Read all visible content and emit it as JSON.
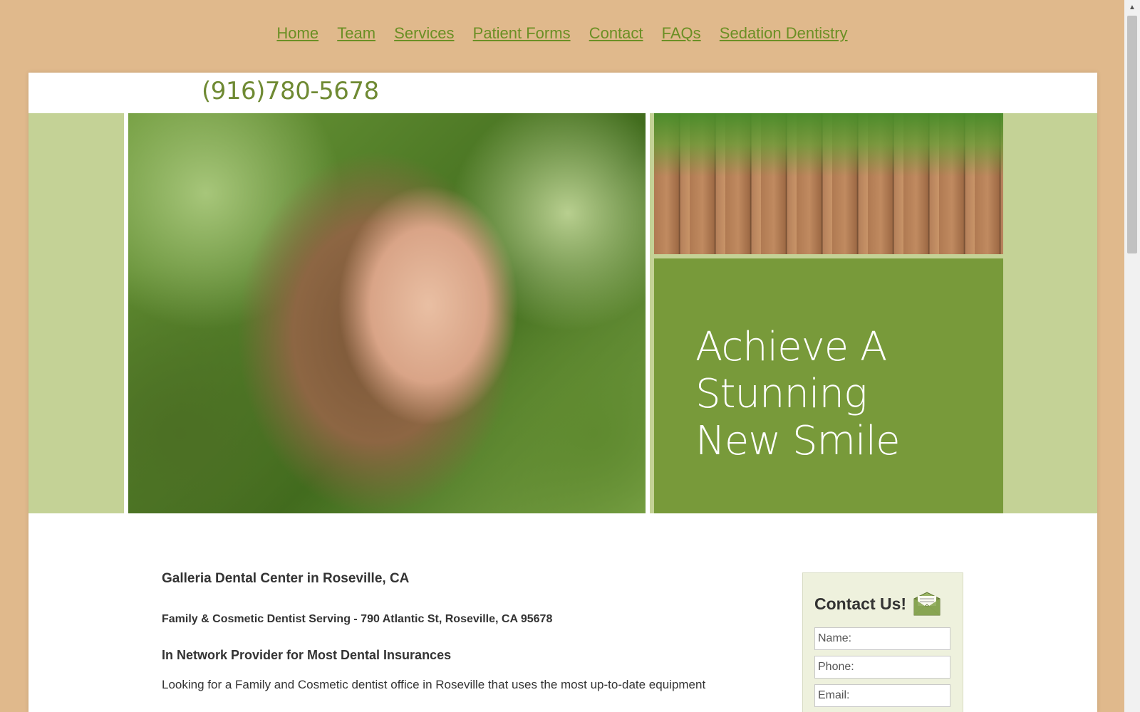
{
  "nav": {
    "items": [
      "Home",
      "Team",
      "Services",
      "Patient Forms",
      "Contact",
      "FAQs",
      "Sedation Dentistry"
    ]
  },
  "header": {
    "phone": "(916)780-5678"
  },
  "banner": {
    "tagline_lines": [
      "Achieve A",
      "Stunning",
      "New Smile"
    ]
  },
  "content": {
    "title": "Galleria Dental Center in Roseville, CA",
    "subtitle": "Family & Cosmetic Dentist Serving - 790 Atlantic St, Roseville, CA 95678",
    "insurance": "In Network Provider for Most Dental Insurances",
    "paragraph": "Looking for a Family and Cosmetic dentist office in Roseville that uses the most up-to-date equipment"
  },
  "contact_form": {
    "title": "Contact Us!",
    "icon": "envelope-icon",
    "fields": {
      "name_placeholder": "Name:",
      "phone_placeholder": "Phone:",
      "email_placeholder": "Email:"
    }
  },
  "colors": {
    "background": "#e0b98c",
    "link": "#6b8f24",
    "accent_green": "#789a3a",
    "banner_side": "#c4d296"
  }
}
